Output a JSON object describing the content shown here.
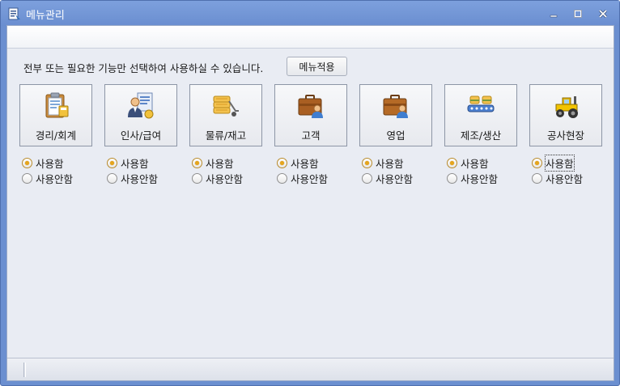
{
  "window": {
    "title": "메뉴관리",
    "accent": "#6b8fd0"
  },
  "instruction": "전부 또는 필요한 기능만 선택하여 사용하실 수 있습니다.",
  "apply_button": "메뉴적용",
  "modules": [
    {
      "label": "경리/회계",
      "icon": "accounting-clipboard-icon",
      "selected": "use"
    },
    {
      "label": "인사/급여",
      "icon": "hr-payroll-icon",
      "selected": "use"
    },
    {
      "label": "물류/재고",
      "icon": "logistics-inventory-icon",
      "selected": "use"
    },
    {
      "label": "고객",
      "icon": "customer-briefcase-icon",
      "selected": "use"
    },
    {
      "label": "영업",
      "icon": "sales-briefcase-icon",
      "selected": "use"
    },
    {
      "label": "제조/생산",
      "icon": "manufacturing-conveyor-icon",
      "selected": "use"
    },
    {
      "label": "공사현장",
      "icon": "construction-tractor-icon",
      "selected": "use"
    }
  ],
  "radio_labels": {
    "use": "사용함",
    "not_use": "사용안함"
  },
  "selected_color": "#e6a51c"
}
